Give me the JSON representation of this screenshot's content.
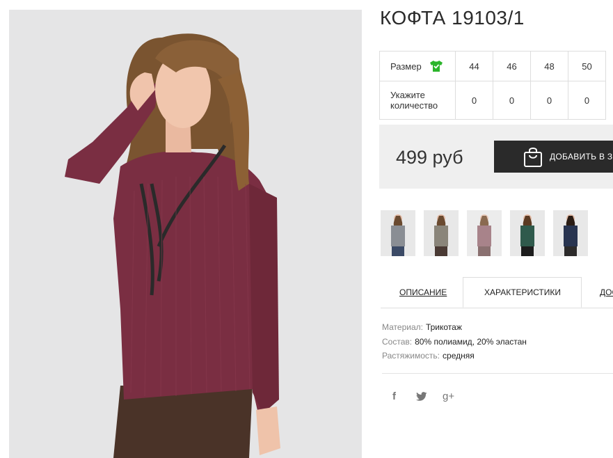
{
  "product": {
    "title": "КОФТА 19103/1",
    "image_alt": "Модель в бордовой кофте"
  },
  "sizes": {
    "header_label": "Размер",
    "size_icon": "tshirt-check-icon",
    "quantity_label_line1": "Укажите",
    "quantity_label_line2": "количество",
    "columns": [
      {
        "size": "44",
        "qty": "0"
      },
      {
        "size": "46",
        "qty": "0"
      },
      {
        "size": "48",
        "qty": "0"
      },
      {
        "size": "50",
        "qty": "0"
      }
    ]
  },
  "buy": {
    "price": "499 руб",
    "add_label": "ДОБАВИТЬ В З",
    "button_icon": "shopping-bag-icon"
  },
  "color_variants": [
    {
      "name": "grey",
      "top": "#8a8e94",
      "bottom": "#3b4a66"
    },
    {
      "name": "beige",
      "top": "#8a857a",
      "bottom": "#4a3a34"
    },
    {
      "name": "pink",
      "top": "#a8838a",
      "bottom": "#8a7070"
    },
    {
      "name": "green",
      "top": "#2f5a4c",
      "bottom": "#1c1c1c"
    },
    {
      "name": "navy",
      "top": "#283450",
      "bottom": "#2c2a2a"
    }
  ],
  "tabs": {
    "description": "ОПИСАНИЕ",
    "characteristics": "ХАРАКТЕРИСТИКИ",
    "delivery": "ДОС"
  },
  "specs": [
    {
      "key": "Материал:",
      "value": "Трикотаж"
    },
    {
      "key": "Состав:",
      "value": "80% полиамид, 20% эластан"
    },
    {
      "key": "Растяжимость:",
      "value": "средняя"
    }
  ],
  "social": {
    "facebook": "f",
    "twitter": "twitter-bird-icon",
    "gplus": "g+"
  },
  "colors": {
    "sweater": "#7a2e42",
    "button_bg": "#2a2a2a",
    "check_green": "#2bb52b"
  }
}
